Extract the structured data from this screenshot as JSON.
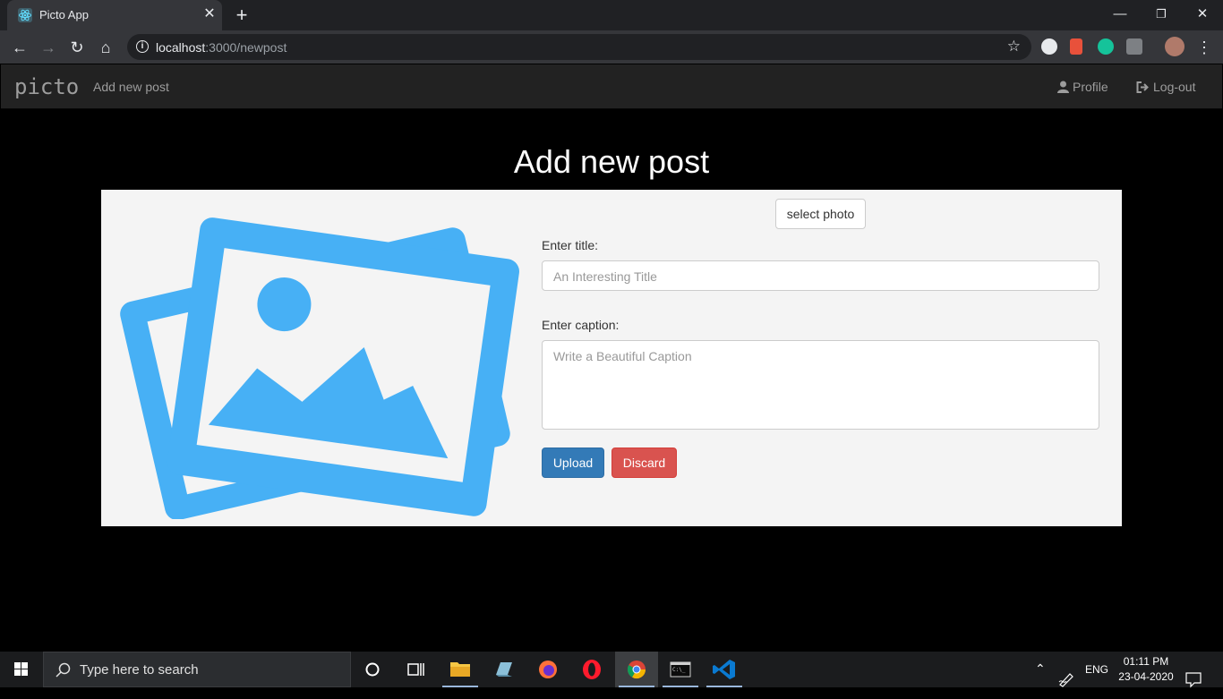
{
  "browser": {
    "tab_title": "Picto App",
    "url_host": "localhost",
    "url_rest": ":3000/newpost"
  },
  "navbar": {
    "brand": "picto",
    "add_post_link": "Add new post",
    "profile_link": "Profile",
    "logout_link": "Log-out"
  },
  "page": {
    "title": "Add new post",
    "select_photo_label": "select photo",
    "title_label": "Enter title:",
    "title_placeholder": "An Interesting Title",
    "caption_label": "Enter caption:",
    "caption_placeholder": "Write a Beautiful Caption",
    "upload_label": "Upload",
    "discard_label": "Discard"
  },
  "colors": {
    "illustration": "#47b0f5",
    "upload_button": "#337ab7",
    "discard_button": "#d9534f"
  },
  "taskbar": {
    "search_placeholder": "Type here to search",
    "language": "ENG",
    "time": "01:11 PM",
    "date": "23-04-2020"
  }
}
